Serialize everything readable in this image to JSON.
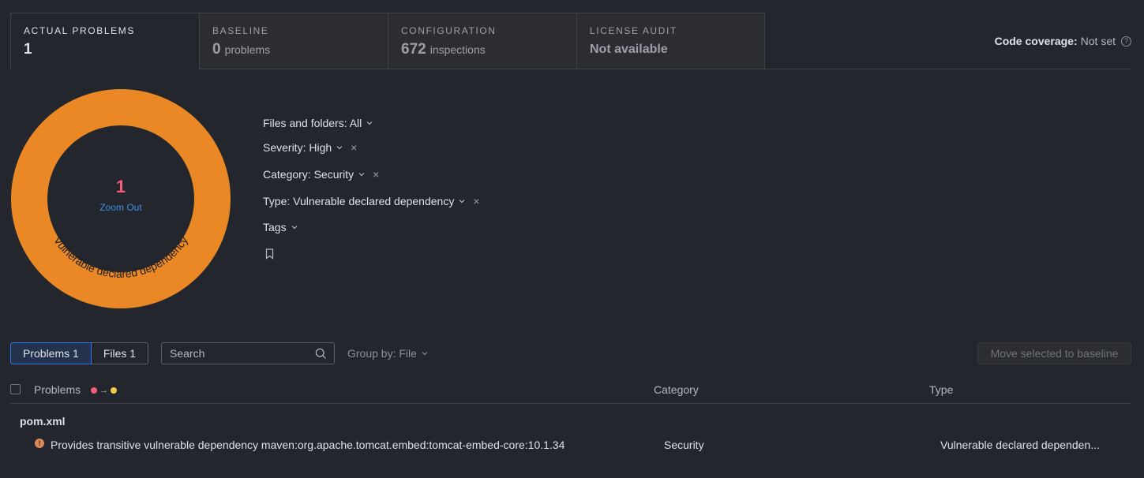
{
  "tabs": [
    {
      "title": "ACTUAL PROBLEMS",
      "num": "1",
      "unit": ""
    },
    {
      "title": "BASELINE",
      "num": "0",
      "unit": "problems"
    },
    {
      "title": "CONFIGURATION",
      "num": "672",
      "unit": "inspections"
    },
    {
      "title": "LICENSE AUDIT",
      "text": "Not available"
    }
  ],
  "coverage": {
    "label": "Code coverage:",
    "value": "Not set"
  },
  "donut": {
    "count": "1",
    "zoom_label": "Zoom Out",
    "segment_label": "Vulnerable declared dependency",
    "segment_color": "#ea8825",
    "count_color": "#f25d7a"
  },
  "filters": {
    "files": "Files and folders: All",
    "severity": "Severity: High",
    "category": "Category: Security",
    "type": "Type: Vulnerable declared dependency",
    "tags": "Tags"
  },
  "toolbar": {
    "problems_tab": "Problems 1",
    "files_tab": "Files 1",
    "search_placeholder": "Search",
    "group_by": "Group by: File",
    "move_button": "Move selected to baseline"
  },
  "table": {
    "headers": {
      "problems": "Problems",
      "category": "Category",
      "type": "Type"
    },
    "severity_colors": [
      "#f25d7a",
      "#f2c94c"
    ],
    "groups": [
      {
        "name": "pom.xml",
        "rows": [
          {
            "problem": "Provides transitive vulnerable dependency maven:org.apache.tomcat.embed:tomcat-embed-core:10.1.34",
            "category": "Security",
            "type": "Vulnerable declared dependen..."
          }
        ]
      }
    ]
  }
}
